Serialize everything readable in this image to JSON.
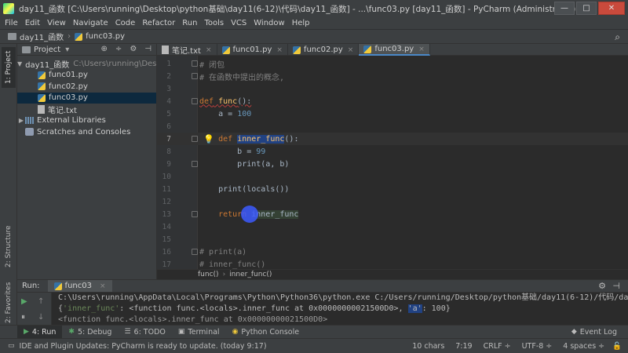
{
  "window": {
    "title": "day11_函数 [C:\\Users\\running\\Desktop\\python基础\\day11(6-12)\\代码\\day11_函数] - ...\\func03.py [day11_函数] - PyCharm (Administrator)",
    "minimize": "—",
    "maximize": "□",
    "close": "✕"
  },
  "menu": [
    "File",
    "Edit",
    "View",
    "Navigate",
    "Code",
    "Refactor",
    "Run",
    "Tools",
    "VCS",
    "Window",
    "Help"
  ],
  "navbar": {
    "project": "day11_函数",
    "file": "func03.py",
    "search_icon": "search-icon"
  },
  "left_strip": {
    "project_tab": "1: Project",
    "structure_tab": "2: Structure",
    "favorites_tab": "2: Favorites"
  },
  "project_panel": {
    "header": "Project",
    "dropdown_arrow": "▾",
    "tools": [
      "⊕",
      "÷",
      "⚙",
      "⊣"
    ],
    "root": {
      "name": "day11_函数",
      "path": "C:\\Users\\running\\Desktop"
    },
    "files": [
      "func01.py",
      "func02.py",
      "func03.py",
      "笔记.txt"
    ],
    "external_libraries": "External Libraries",
    "scratches": "Scratches and Consoles"
  },
  "tabs": [
    {
      "label": "笔记.txt",
      "close": "×"
    },
    {
      "label": "func01.py",
      "close": "×"
    },
    {
      "label": "func02.py",
      "close": "×"
    },
    {
      "label": "func03.py",
      "close": "×"
    }
  ],
  "editor": {
    "lines": [
      {
        "n": "1",
        "code": "# 闭包"
      },
      {
        "n": "2",
        "code": "# 在函数中提出的概念,"
      },
      {
        "n": "3",
        "code": ""
      },
      {
        "n": "4",
        "code": "def func():"
      },
      {
        "n": "5",
        "code": "    a = 100"
      },
      {
        "n": "6",
        "code": ""
      },
      {
        "n": "7",
        "code": "    def inner_func():"
      },
      {
        "n": "8",
        "code": "        b = 99"
      },
      {
        "n": "9",
        "code": "        print(a, b)"
      },
      {
        "n": "10",
        "code": ""
      },
      {
        "n": "11",
        "code": "    print(locals())"
      },
      {
        "n": "12",
        "code": ""
      },
      {
        "n": "13",
        "code": "    return inner_func"
      },
      {
        "n": "14",
        "code": ""
      },
      {
        "n": "15",
        "code": ""
      },
      {
        "n": "16",
        "code": "# print(a)"
      },
      {
        "n": "17",
        "code": "# inner_func()"
      }
    ],
    "tokens": {
      "kw_def": "def",
      "fn_func": "func",
      "paren_colon": "():",
      "indent4": "    ",
      "indent8": "        ",
      "inner_name": "inner_func",
      "a_eq": "a = ",
      "a_val": "100",
      "b_eq": "b = ",
      "b_val": "99",
      "print_ab": "print(a, b)",
      "print_locals": "print(locals())",
      "kw_return": "return",
      "return_name": "inner_func",
      "comment1": "# 闭包",
      "comment2": "# 在函数中提出的概念,",
      "comment16": "# print(a)",
      "comment17": "# inner_func()",
      "space": " "
    },
    "breadcrumb": [
      "func()",
      "inner_func()"
    ]
  },
  "run_panel": {
    "label": "Run:",
    "tab": "func03",
    "console": {
      "line1": "C:\\Users\\running\\AppData\\Local\\Programs\\Python\\Python36\\python.exe C:/Users/running/Desktop/python基础/day11(6-12)/代码/day11_",
      "line2_pre": "{",
      "line2_k1": "'inner_func'",
      "line2_mid": ": <function func.<locals>.inner_func at 0x00000000021500D0>, ",
      "line2_k2": "'a'",
      "line2_post": ": 100}",
      "line3": "<function func.<locals>.inner_func at 0x00000000021500D0>"
    }
  },
  "tool_tabs": [
    {
      "icon": "▶",
      "label": "4: Run",
      "name": "run-tool-tab"
    },
    {
      "icon": "✱",
      "label": "5: Debug",
      "name": "debug-tool-tab"
    },
    {
      "icon": "☰",
      "label": "6: TODO",
      "name": "todo-tool-tab"
    },
    {
      "icon": "▣",
      "label": "Terminal",
      "name": "terminal-tool-tab"
    },
    {
      "icon": "◉",
      "label": "Python Console",
      "name": "python-console-tool-tab"
    }
  ],
  "event_log": "Event Log",
  "status": {
    "message": "IDE and Plugin Updates: PyCharm is ready to update. (today 9:17)",
    "chars": "10 chars",
    "position": "7:19",
    "line_sep": "CRLF ÷",
    "encoding": "UTF-8 ÷",
    "indent": "4 spaces ÷"
  }
}
